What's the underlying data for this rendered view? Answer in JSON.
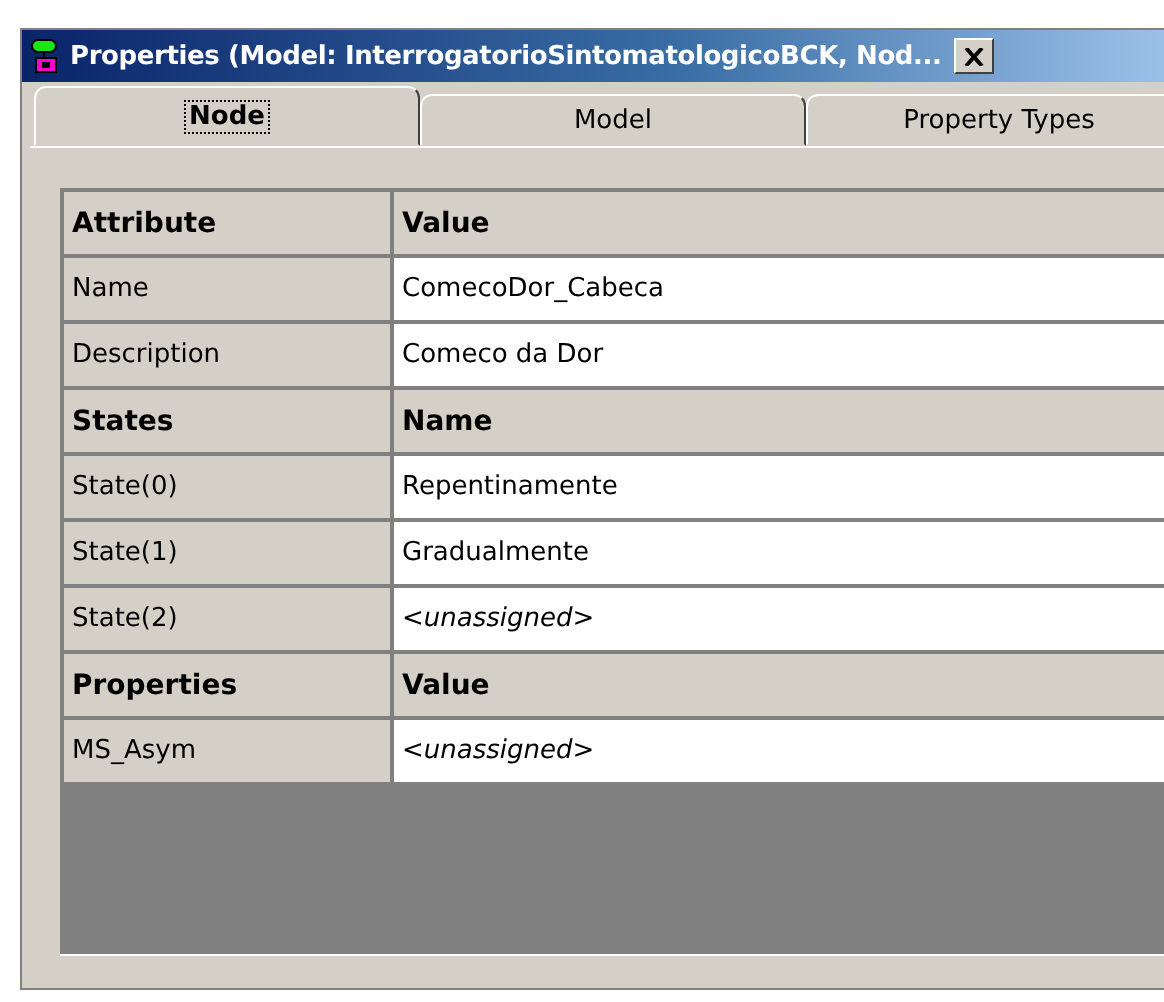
{
  "window": {
    "title": "Properties  (Model: InterrogatorioSintomatologicoBCK,  Nod..."
  },
  "tabs": [
    {
      "label": "Node",
      "selected": true
    },
    {
      "label": "Model",
      "selected": false
    },
    {
      "label": "Property Types",
      "selected": false
    }
  ],
  "table": {
    "rows": [
      {
        "kind": "header",
        "cells": [
          "Attribute",
          "Value"
        ]
      },
      {
        "kind": "attribute",
        "cells": [
          "Name",
          "ComecoDor_Cabeca"
        ],
        "assigned": true
      },
      {
        "kind": "attribute",
        "cells": [
          "Description",
          "Comeco da Dor"
        ],
        "assigned": true
      },
      {
        "kind": "header",
        "cells": [
          "States",
          "Name"
        ]
      },
      {
        "kind": "attribute",
        "cells": [
          "State(0)",
          "Repentinamente"
        ],
        "assigned": true
      },
      {
        "kind": "attribute",
        "cells": [
          "State(1)",
          "Gradualmente"
        ],
        "assigned": true
      },
      {
        "kind": "attribute",
        "cells": [
          "State(2)",
          "<unassigned>"
        ],
        "assigned": false
      },
      {
        "kind": "header",
        "cells": [
          "Properties",
          "Value"
        ]
      },
      {
        "kind": "attribute",
        "cells": [
          "MS_Asym",
          "<unassigned>"
        ],
        "assigned": false
      }
    ]
  }
}
